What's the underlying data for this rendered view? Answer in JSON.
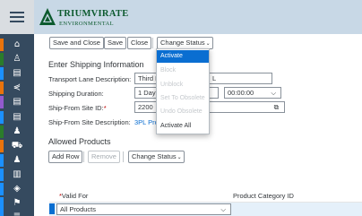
{
  "logo": {
    "line1": "TRIUMVIRATE",
    "line2": "ENVIRONMENTAL"
  },
  "rail": {
    "items": [
      {
        "icon": "briefcase-icon",
        "glyph": "⌂",
        "color": "#e9730c"
      },
      {
        "icon": "user-icon",
        "glyph": "♙",
        "color": "#2b7c2b"
      },
      {
        "icon": "document-icon",
        "glyph": "▤",
        "color": "#1b90ff"
      },
      {
        "icon": "share-icon",
        "glyph": "⋞",
        "color": "#e9730c"
      },
      {
        "icon": "clipboard-icon",
        "glyph": "▤",
        "color": "#925ace"
      },
      {
        "icon": "list-icon",
        "glyph": "▤",
        "color": "#1b90ff"
      },
      {
        "icon": "people-icon",
        "glyph": "♟",
        "color": "#2b7c2b"
      },
      {
        "icon": "car-icon",
        "glyph": "⛟",
        "color": "#e9730c"
      },
      {
        "icon": "group-icon",
        "glyph": "♟",
        "color": "#1b90ff"
      },
      {
        "icon": "chart-icon",
        "glyph": "▥",
        "color": "#1b90ff"
      },
      {
        "icon": "cube-icon",
        "glyph": "◈",
        "color": "#1b90ff"
      },
      {
        "icon": "flag-icon",
        "glyph": "⚑",
        "color": "#1b90ff"
      },
      {
        "icon": "more-icon",
        "glyph": "≡",
        "color": "#1b90ff"
      }
    ]
  },
  "toolbar": {
    "save_close": "Save and Close",
    "save": "Save",
    "close": "Close",
    "change_status": "Change Status"
  },
  "section": {
    "title": "Enter Shipping Information",
    "transport_label": "Transport Lane Description:",
    "transport_value": "Third P",
    "transport_value_tail": "L",
    "duration_label": "Shipping Duration:",
    "duration_days": "1 Day(",
    "duration_time": "00:00:00",
    "site_id_label": "Ship-From Site ID:",
    "site_id_value": "2200",
    "site_desc_label": "Ship-From Site Description:",
    "site_desc_value": "3PL Pro"
  },
  "products": {
    "title": "Allowed Products",
    "add_row": "Add Row",
    "remove": "Remove",
    "change_status": "Change Status",
    "col_valid_for": "Valid For",
    "col_category": "Product Category ID",
    "row_value": "All Products"
  },
  "status_menu": {
    "items": [
      {
        "label": "Activate",
        "state": "active"
      },
      {
        "label": "Block",
        "state": "disabled"
      },
      {
        "label": "Unblock",
        "state": "disabled"
      },
      {
        "label": "Set To Obsolete",
        "state": "disabled"
      },
      {
        "label": "Undo Obsolete",
        "state": "disabled"
      },
      {
        "label": "Activate All",
        "state": "enabled"
      }
    ]
  }
}
